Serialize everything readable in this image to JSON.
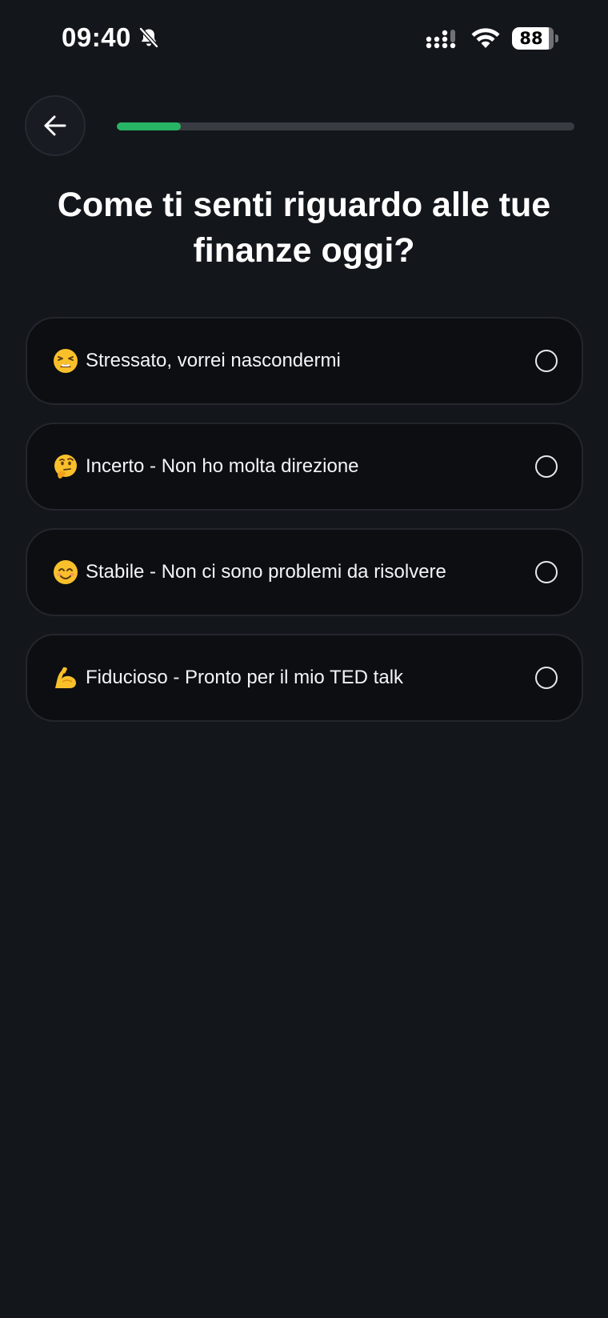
{
  "status_bar": {
    "time": "09:40",
    "battery_level": "88",
    "icons": [
      "bell-slash-icon",
      "cellular-signal-icon",
      "wifi-icon",
      "battery-icon"
    ]
  },
  "header": {
    "back_icon": "arrow-left-icon",
    "progress_fraction": 0.14,
    "progress_color": "#27b565"
  },
  "title": "Come ti senti riguardo alle tue finanze oggi?",
  "options": [
    {
      "emoji": "tired-face-emoji",
      "label": "Stressato, vorrei nascondermi",
      "selected": false
    },
    {
      "emoji": "thinking-face-emoji",
      "label": "Incerto - Non ho molta direzione",
      "selected": false
    },
    {
      "emoji": "smiling-face-emoji",
      "label": "Stabile - Non ci sono problemi da risolvere",
      "selected": false
    },
    {
      "emoji": "flexed-biceps-emoji",
      "label": "Fiducioso - Pronto per il mio TED talk",
      "selected": false
    }
  ],
  "colors": {
    "background": "#13161b",
    "card": "#0c0e12",
    "accent": "#27b565"
  }
}
